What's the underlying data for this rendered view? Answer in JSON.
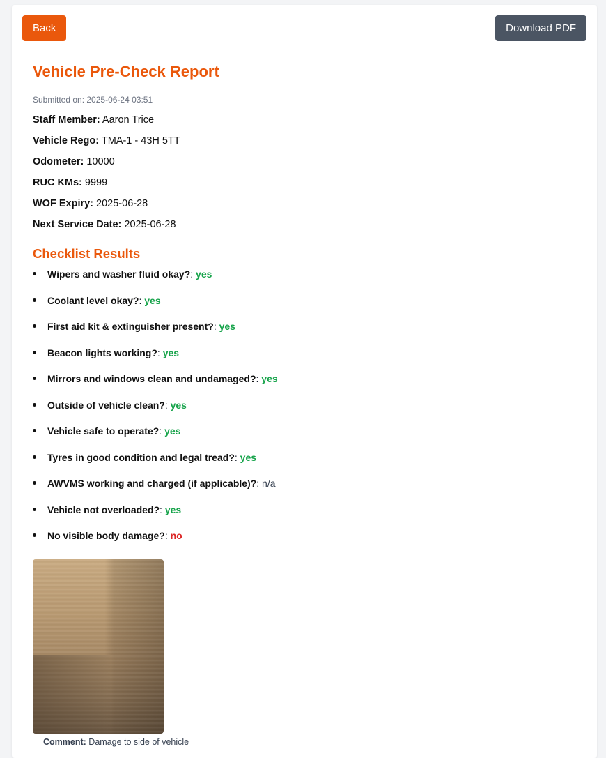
{
  "buttons": {
    "back": "Back",
    "download_pdf": "Download PDF"
  },
  "report": {
    "title": "Vehicle Pre-Check Report",
    "submitted": "Submitted on: 2025-06-24 03:51"
  },
  "fields": [
    {
      "label": "Staff Member:",
      "value": "Aaron Trice"
    },
    {
      "label": "Vehicle Rego:",
      "value": "TMA-1 - 43H 5TT"
    },
    {
      "label": "Odometer:",
      "value": "10000"
    },
    {
      "label": "RUC KMs:",
      "value": "9999"
    },
    {
      "label": "WOF Expiry:",
      "value": "2025-06-28"
    },
    {
      "label": "Next Service Date:",
      "value": "2025-06-28"
    }
  ],
  "checklist": {
    "title": "Checklist Results",
    "items": [
      {
        "question": "Wipers and washer fluid okay?",
        "answer": "yes"
      },
      {
        "question": "Coolant level okay?",
        "answer": "yes"
      },
      {
        "question": "First aid kit & extinguisher present?",
        "answer": "yes"
      },
      {
        "question": "Beacon lights working?",
        "answer": "yes"
      },
      {
        "question": "Mirrors and windows clean and undamaged?",
        "answer": "yes"
      },
      {
        "question": "Outside of vehicle clean?",
        "answer": "yes"
      },
      {
        "question": "Vehicle safe to operate?",
        "answer": "yes"
      },
      {
        "question": "Tyres in good condition and legal tread?",
        "answer": "yes"
      },
      {
        "question": "AWVMS working and charged (if applicable)?",
        "answer": "n/a"
      },
      {
        "question": "Vehicle not overloaded?",
        "answer": "yes"
      },
      {
        "question": "No visible body damage?",
        "answer": "no"
      }
    ]
  },
  "damage": {
    "comment_label": "Comment:",
    "comment_text": "Damage to side of vehicle"
  },
  "colors": {
    "accent": "#ea580c",
    "secondary_button": "#4b5563",
    "yes": "#16a34a",
    "no": "#dc2626",
    "page_bg": "#f3f4f6"
  }
}
